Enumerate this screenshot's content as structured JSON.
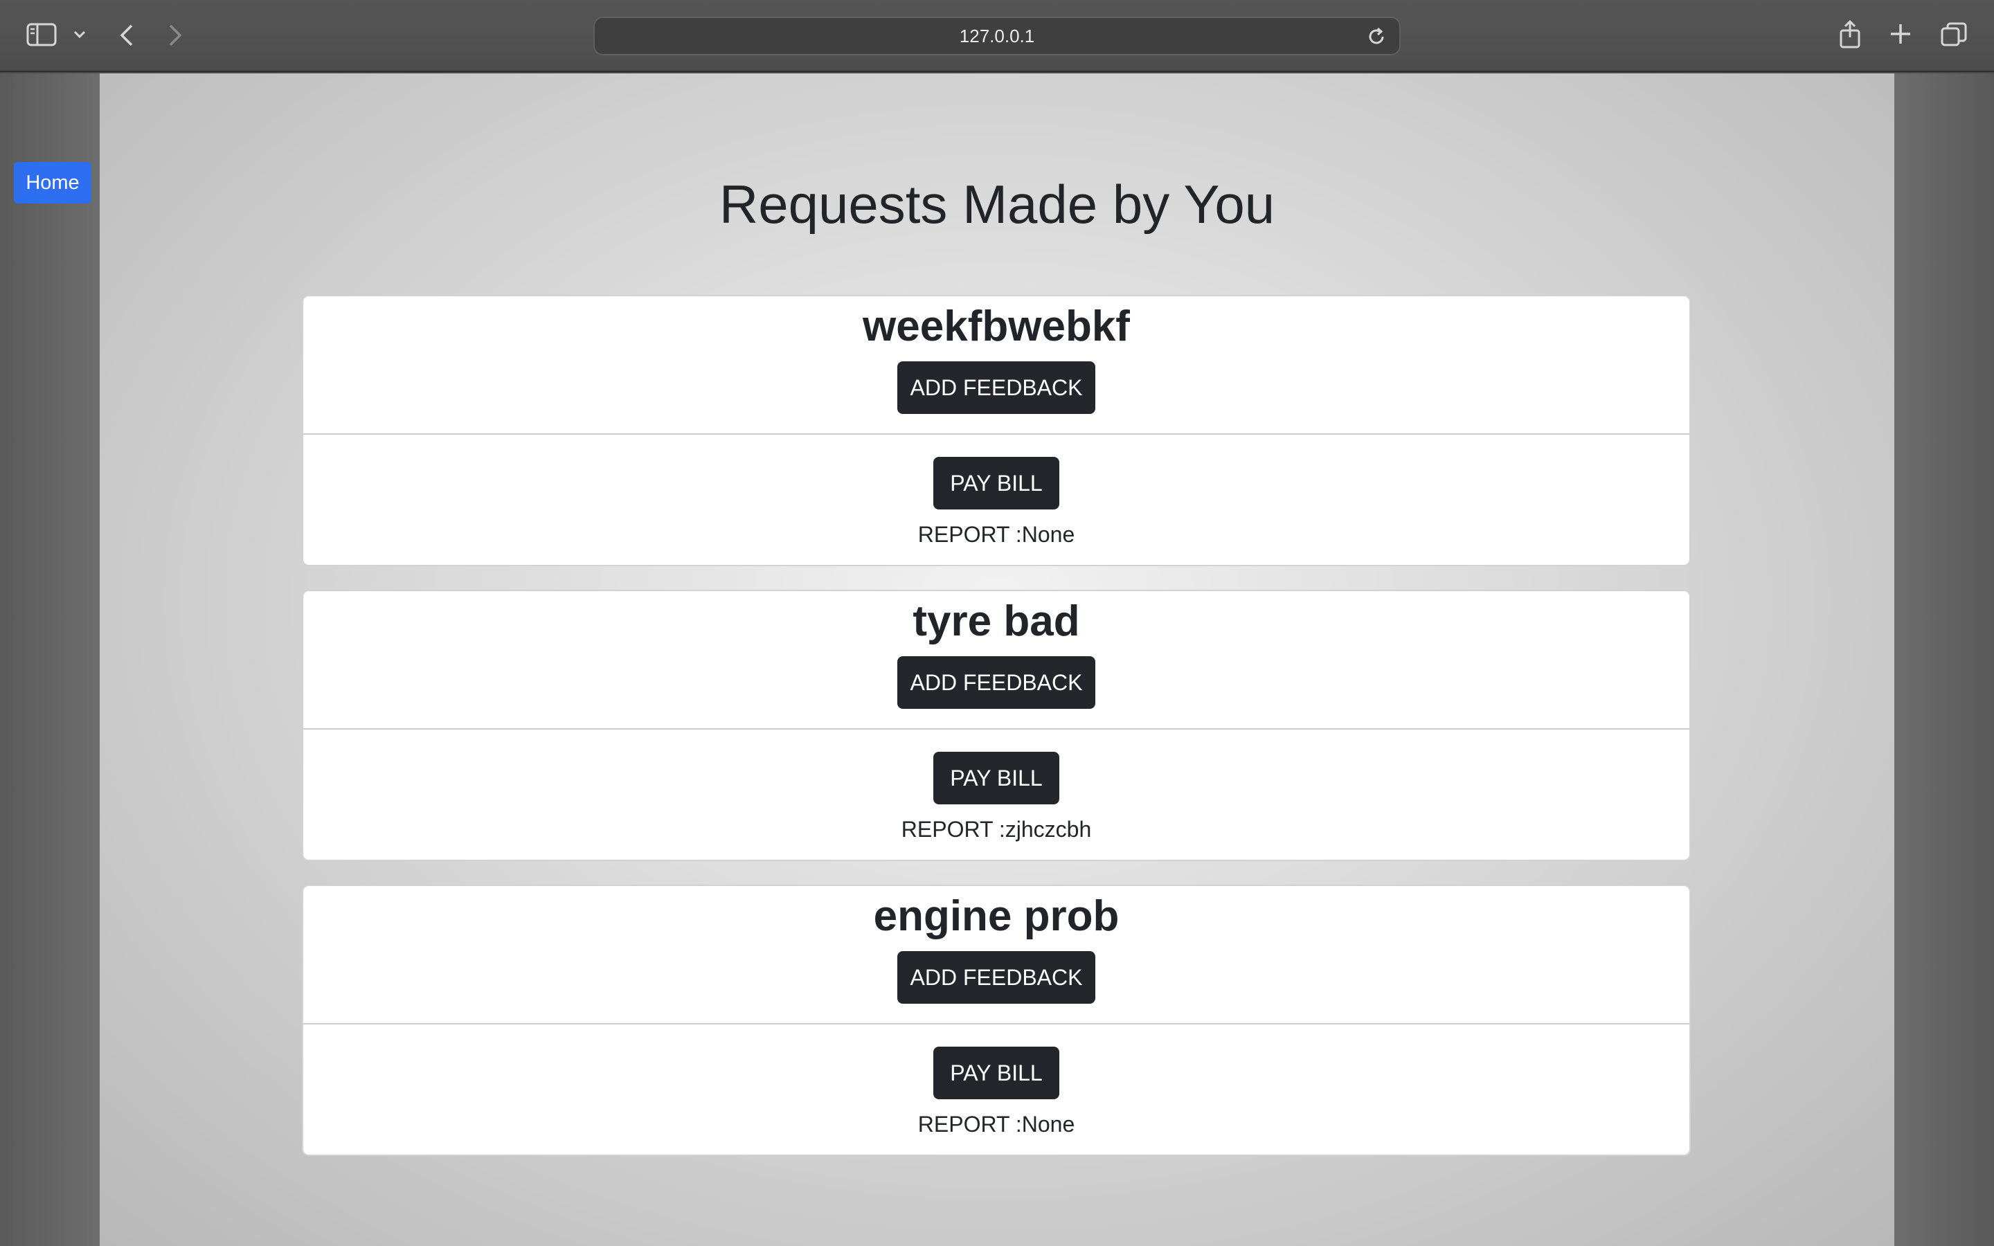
{
  "browser": {
    "address": "127.0.0.1",
    "icons": [
      "sidebar-icon",
      "chevron-down-icon",
      "back-icon",
      "forward-icon",
      "reload-icon",
      "share-icon",
      "new-tab-icon",
      "tabs-overview-icon"
    ]
  },
  "nav": {
    "home_label": "Home"
  },
  "page": {
    "title": "Requests Made by You"
  },
  "requests": [
    {
      "title": "weekfbwebkf",
      "feedback_label": "ADD FEEDBACK",
      "pay_label": "PAY BILL",
      "report_label": "REPORT :",
      "report_value": "None"
    },
    {
      "title": "tyre bad",
      "feedback_label": "ADD FEEDBACK",
      "pay_label": "PAY BILL",
      "report_label": "REPORT :",
      "report_value": "zjhczcbh"
    },
    {
      "title": "engine prob",
      "feedback_label": "ADD FEEDBACK",
      "pay_label": "PAY BILL",
      "report_label": "REPORT :",
      "report_value": "None"
    }
  ],
  "colors": {
    "home_button": "#2e6ff2",
    "dark_button": "#23272b",
    "text": "#212529"
  }
}
